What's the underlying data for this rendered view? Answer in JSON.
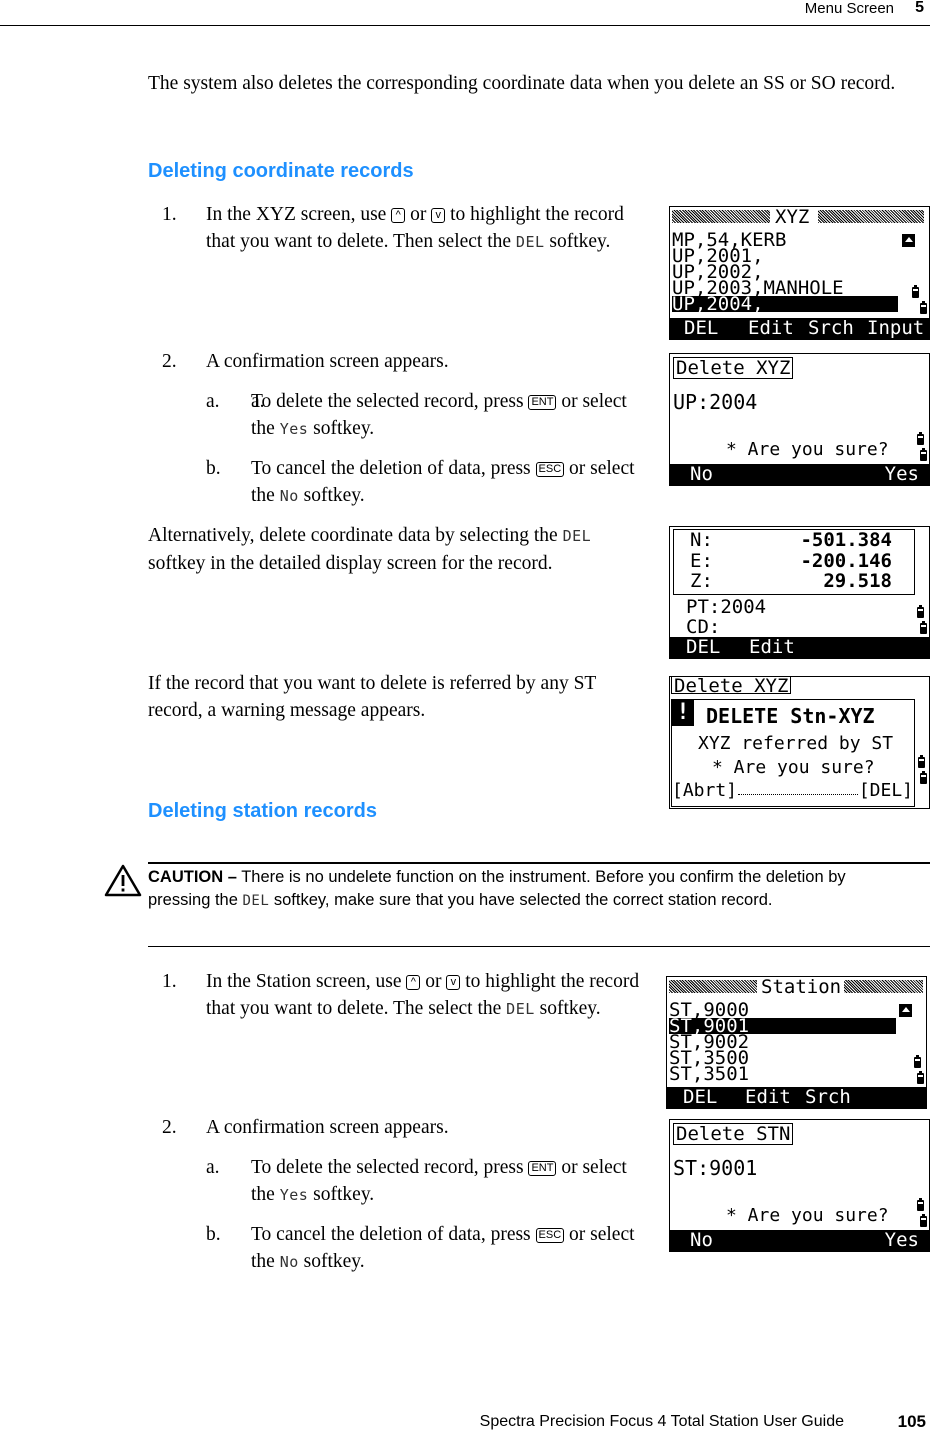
{
  "header": {
    "section_title": "Menu Screen",
    "chapter_number": "5"
  },
  "footer": {
    "guide_title": "Spectra Precision Focus 4 Total Station User Guide",
    "page_number": "105"
  },
  "intro": {
    "text": "The system also deletes the corresponding coordinate data when you delete an SS or SO record."
  },
  "sections": {
    "coordinate": {
      "heading": "Deleting coordinate records",
      "step1": {
        "num": "1.",
        "pre": "In the XYZ screen, use ",
        "key_up": "^",
        "mid": " or ",
        "key_down": "v",
        "post": " to highlight the record that you want to delete. Then select the ",
        "softkey": "DEL",
        "end": " softkey."
      },
      "step2": {
        "num": "2.",
        "text": "A confirmation screen appears.",
        "a": {
          "label": "a.",
          "pre": "To delete the selected record, press ",
          "key": "ENT",
          "mid": " or select the ",
          "softkey": "Yes",
          "end": " softkey."
        },
        "b": {
          "label": "b.",
          "pre": "To cancel the deletion of data, press ",
          "key": "ESC",
          "mid": " or select the ",
          "softkey": "No",
          "end": " softkey."
        }
      },
      "alt": {
        "pre": "Alternatively, delete coordinate data by selecting the ",
        "softkey": "DEL",
        "post": " softkey in the detailed display screen for the record."
      },
      "warning": {
        "text": "If the record that you want to delete is referred by any ST record, a warning message appears."
      }
    },
    "station": {
      "heading": "Deleting station records",
      "caution": {
        "label": "CAUTION –",
        "pre": " There is no undelete function on the instrument. Before you confirm the deletion by pressing the ",
        "softkey": "DEL",
        "post": " softkey, make sure that you have selected the correct station record."
      },
      "step1": {
        "num": "1.",
        "pre": "In the Station screen, use ",
        "key_up": "^",
        "mid": " or ",
        "key_down": "v",
        "post": " to highlight the record that you want to delete. The select the ",
        "softkey": "DEL",
        "end": " softkey."
      },
      "step2": {
        "num": "2.",
        "text": "A confirmation screen appears.",
        "a": {
          "label": "a.",
          "pre": "To delete the selected record, press ",
          "key": "ENT",
          "mid": " or select the ",
          "softkey": "Yes",
          "end": " softkey."
        },
        "b": {
          "label": "b.",
          "pre": "To cancel the deletion of data, press ",
          "key": "ESC",
          "mid": " or select the ",
          "softkey": "No",
          "end": " softkey."
        }
      }
    }
  },
  "screens": {
    "xyz_list": {
      "title": "XYZ",
      "rows": [
        "MP,54,KERB",
        "UP,2001,",
        "UP,2002,",
        "UP,2003,MANHOLE",
        "UP,2004,"
      ],
      "selected_index": 4,
      "softkeys": [
        "DEL",
        "Edit",
        "Srch",
        "Input"
      ]
    },
    "delete_xyz": {
      "title": "Delete XYZ",
      "record": "UP:2004",
      "prompt": "* Are you sure?",
      "softkeys": [
        "No",
        "Yes"
      ]
    },
    "detail": {
      "n_label": "N:",
      "n_value": "-501.384",
      "e_label": "E:",
      "e_value": "-200.146",
      "z_label": "Z:",
      "z_value": "29.518",
      "pt": "PT:2004",
      "cd": "CD:",
      "softkeys": [
        "DEL",
        "Edit"
      ]
    },
    "warning": {
      "background_title": "Delete XYZ",
      "icon": "!",
      "title": "DELETE Stn-XYZ",
      "message": "XYZ referred by ST",
      "prompt": "* Are you sure?",
      "abort": "[Abrt]",
      "delete": "[DEL]"
    },
    "station_list": {
      "title": "Station",
      "rows": [
        "ST,9000",
        "ST,9001",
        "ST,9002",
        "ST,3500",
        "ST,3501"
      ],
      "selected_index": 1,
      "softkeys": [
        "DEL",
        "Edit",
        "Srch"
      ]
    },
    "delete_stn": {
      "title": "Delete STN",
      "record": "ST:9001",
      "prompt": "* Are you sure?",
      "softkeys": [
        "No",
        "Yes"
      ]
    }
  },
  "colors": {
    "heading": "#1e90ff",
    "text": "#000000"
  }
}
